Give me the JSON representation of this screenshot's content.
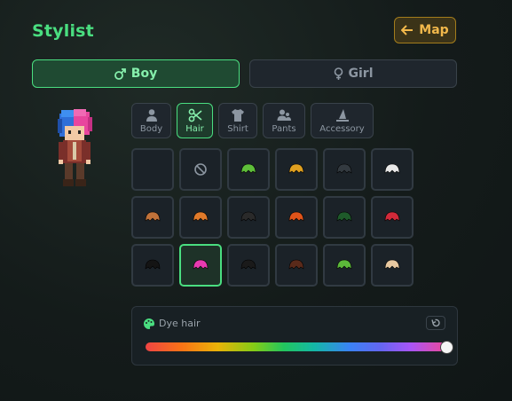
{
  "header": {
    "title": "Stylist",
    "map_label": "Map"
  },
  "gender": {
    "boy_label": "Boy",
    "girl_label": "Girl",
    "selected": "boy"
  },
  "tabs": [
    {
      "label": "Body",
      "icon": "person-icon",
      "active": false
    },
    {
      "label": "Hair",
      "icon": "scissors-icon",
      "active": true
    },
    {
      "label": "Shirt",
      "icon": "shirt-icon",
      "active": false
    },
    {
      "label": "Pants",
      "icon": "people-icon",
      "active": false
    },
    {
      "label": "Accessory",
      "icon": "hat-icon",
      "active": false
    }
  ],
  "hair_grid": [
    {
      "kind": "empty"
    },
    {
      "kind": "none"
    },
    {
      "color": "#5fbf3a"
    },
    {
      "color": "#e0a020"
    },
    {
      "color": "#333a40"
    },
    {
      "color": "#e8e8e8"
    },
    {
      "color": "#c0723a"
    },
    {
      "color": "#e07a2a"
    },
    {
      "color": "#2a2a2a"
    },
    {
      "color": "#e0541a"
    },
    {
      "color": "#1e5a2a"
    },
    {
      "color": "#d02a3a"
    },
    {
      "color": "#141414"
    },
    {
      "color": "#e83ab0",
      "selected": true
    },
    {
      "color": "#1a1a1a"
    },
    {
      "color": "#5a2a1a"
    },
    {
      "color": "#5cb83a"
    },
    {
      "color": "#e8c8a0"
    }
  ],
  "dye": {
    "label": "Dye hair",
    "value": 1.0
  },
  "colors": {
    "accent": "#4ade80",
    "map": "#f2b84b"
  }
}
